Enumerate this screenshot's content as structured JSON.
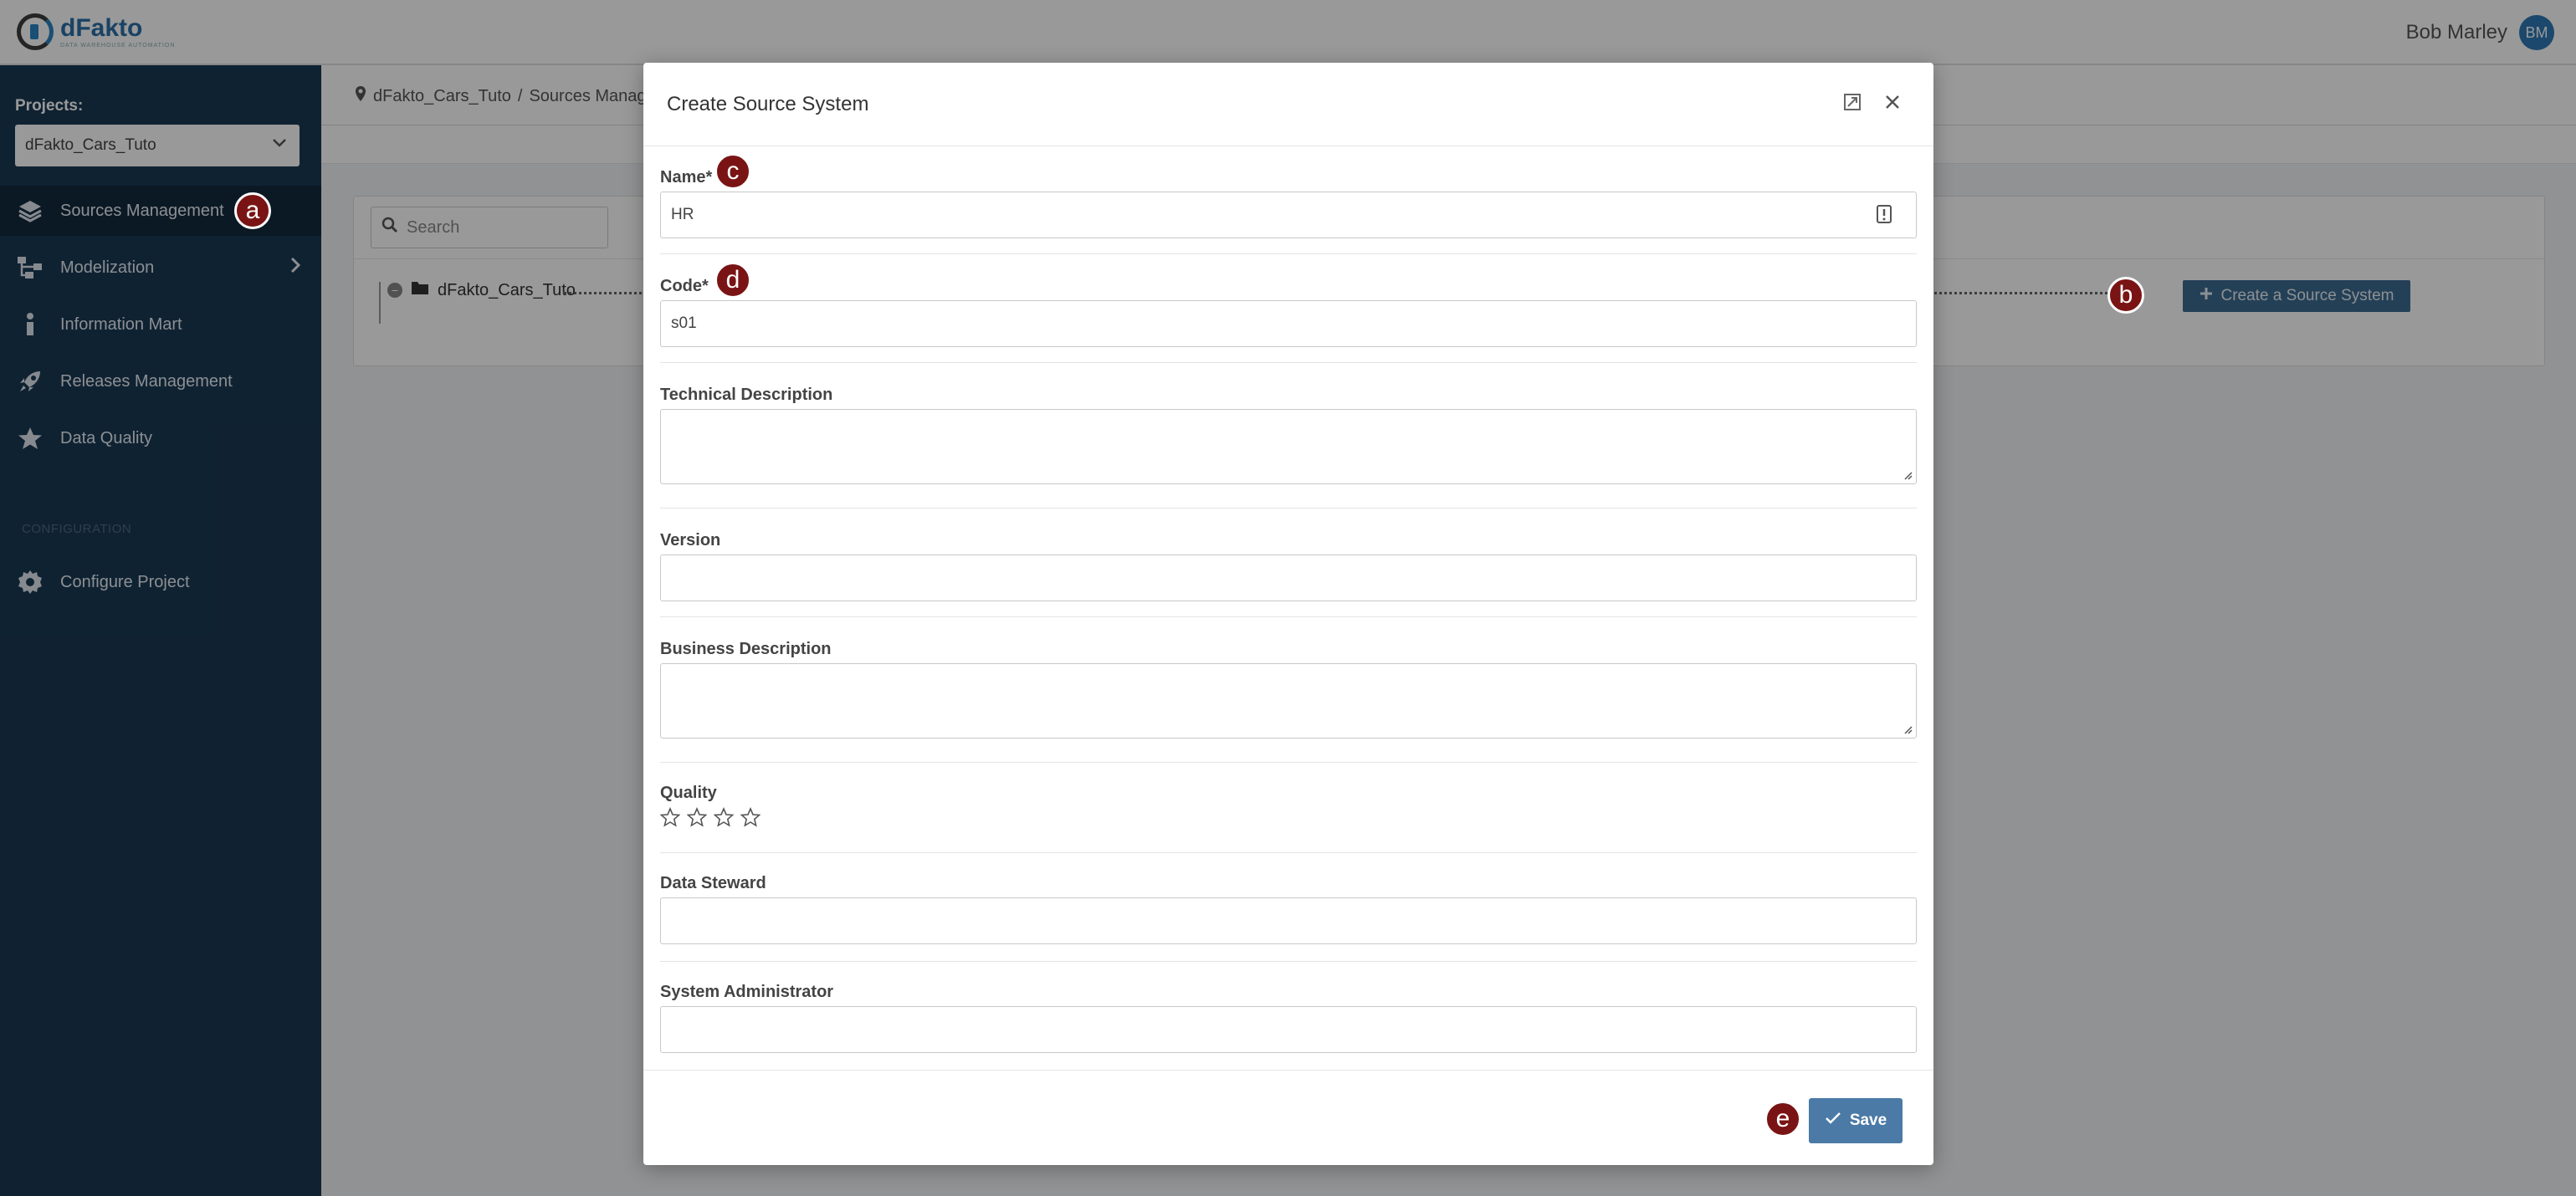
{
  "app": {
    "name": "dFakto",
    "tagline": "DATA WAREHOUSE AUTOMATION"
  },
  "user": {
    "name": "Bob Marley",
    "initials": "BM"
  },
  "sidebar": {
    "projects_label": "Projects:",
    "project_selected": "dFakto_Cars_Tuto",
    "items": [
      {
        "label": "Sources Management",
        "icon": "layers-icon",
        "active": true
      },
      {
        "label": "Modelization",
        "icon": "hierarchy-icon",
        "has_submenu": true
      },
      {
        "label": "Information Mart",
        "icon": "info-icon"
      },
      {
        "label": "Releases Management",
        "icon": "rocket-icon"
      },
      {
        "label": "Data Quality",
        "icon": "star-icon"
      }
    ],
    "config_heading": "CONFIGURATION",
    "config_items": [
      {
        "label": "Configure Project",
        "icon": "gear-icon"
      }
    ]
  },
  "breadcrumb": {
    "project": "dFakto_Cars_Tuto",
    "separator": "/",
    "page": "Sources Managen"
  },
  "tree": {
    "search_placeholder": "Search",
    "root_label": "dFakto_Cars_Tuto",
    "create_button": "Create a Source System"
  },
  "modal": {
    "title": "Create Source System",
    "fields": {
      "name": {
        "label": "Name*",
        "value": "HR"
      },
      "code": {
        "label": "Code*",
        "value": "s01"
      },
      "technical_description": {
        "label": "Technical Description",
        "value": ""
      },
      "version": {
        "label": "Version",
        "value": ""
      },
      "business_description": {
        "label": "Business Description",
        "value": ""
      },
      "quality": {
        "label": "Quality",
        "stars_total": 4,
        "stars_filled": 0
      },
      "data_steward": {
        "label": "Data Steward",
        "value": ""
      },
      "system_administrator": {
        "label": "System Administrator",
        "value": ""
      }
    },
    "save_label": "Save"
  },
  "markers": [
    "a",
    "b",
    "c",
    "d",
    "e"
  ],
  "colors": {
    "sidebar_bg": "#1a3954",
    "primary_button": "#4b7aa6",
    "marker_bg": "#7a1414",
    "brand": "#2b6fa8"
  }
}
